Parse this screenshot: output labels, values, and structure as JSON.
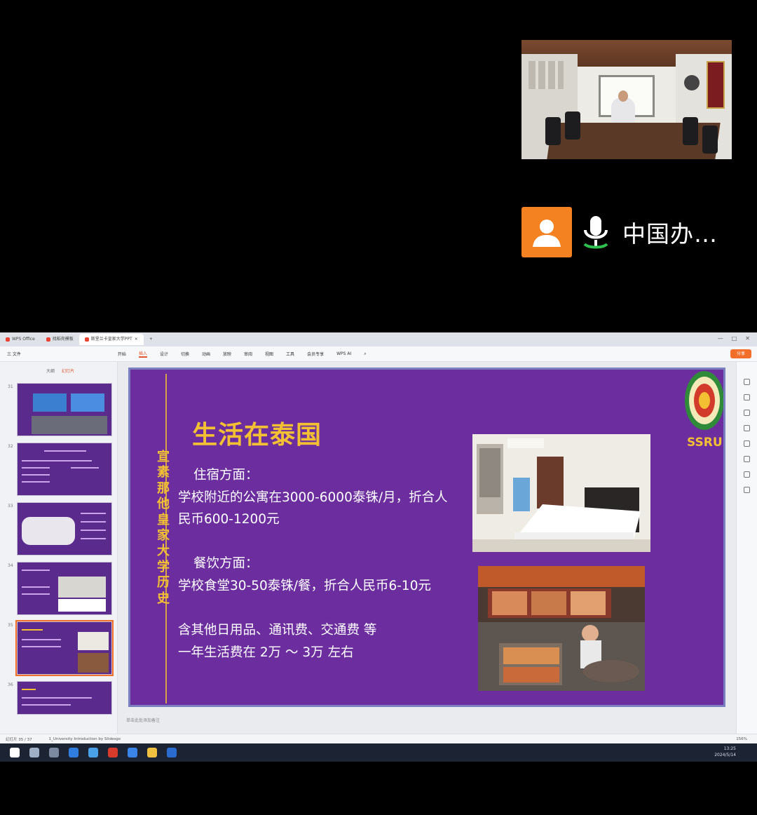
{
  "call": {
    "participant_name": "中国办…"
  },
  "tabs": [
    "WPS Office",
    "找稻壳模板",
    "斯里兰卡皇家大学PPT"
  ],
  "ribbon": {
    "file": "三 文件",
    "tabs": [
      "开始",
      "插入",
      "设计",
      "切换",
      "动画",
      "放映",
      "审阅",
      "视图",
      "工具",
      "会员专享",
      "WPS AI"
    ],
    "share": "分享"
  },
  "panel": {
    "tabs": [
      "大纲",
      "幻灯片"
    ],
    "thumbs": [
      "31",
      "32",
      "33",
      "34",
      "35",
      "36"
    ]
  },
  "slide": {
    "vertical_title": "宣素那他皇家大学历史",
    "title": "生活在泰国",
    "housing_heading": "住宿方面：",
    "housing_line1": "学校附近的公寓在3000-6000泰铢/月，折合人",
    "housing_line2": "民币600-1200元",
    "dining_heading": "餐饮方面：",
    "dining_line": "学校食堂30-50泰铢/餐，折合人民币6-10元",
    "other_line": "含其他日用品、通讯费、交通费 等",
    "annual_line": "一年生活费在 2万 ～ 3万 左右",
    "logo_text": "SSRU"
  },
  "editor": {
    "notes_placeholder": "单击此处添加备注"
  },
  "status": {
    "slide_counter": "幻灯片 35 / 37",
    "template": "1_University Introduction by Slidesgo",
    "zoom": "156%"
  },
  "taskbar": {
    "time": "13:25",
    "date": "2024/5/14"
  }
}
